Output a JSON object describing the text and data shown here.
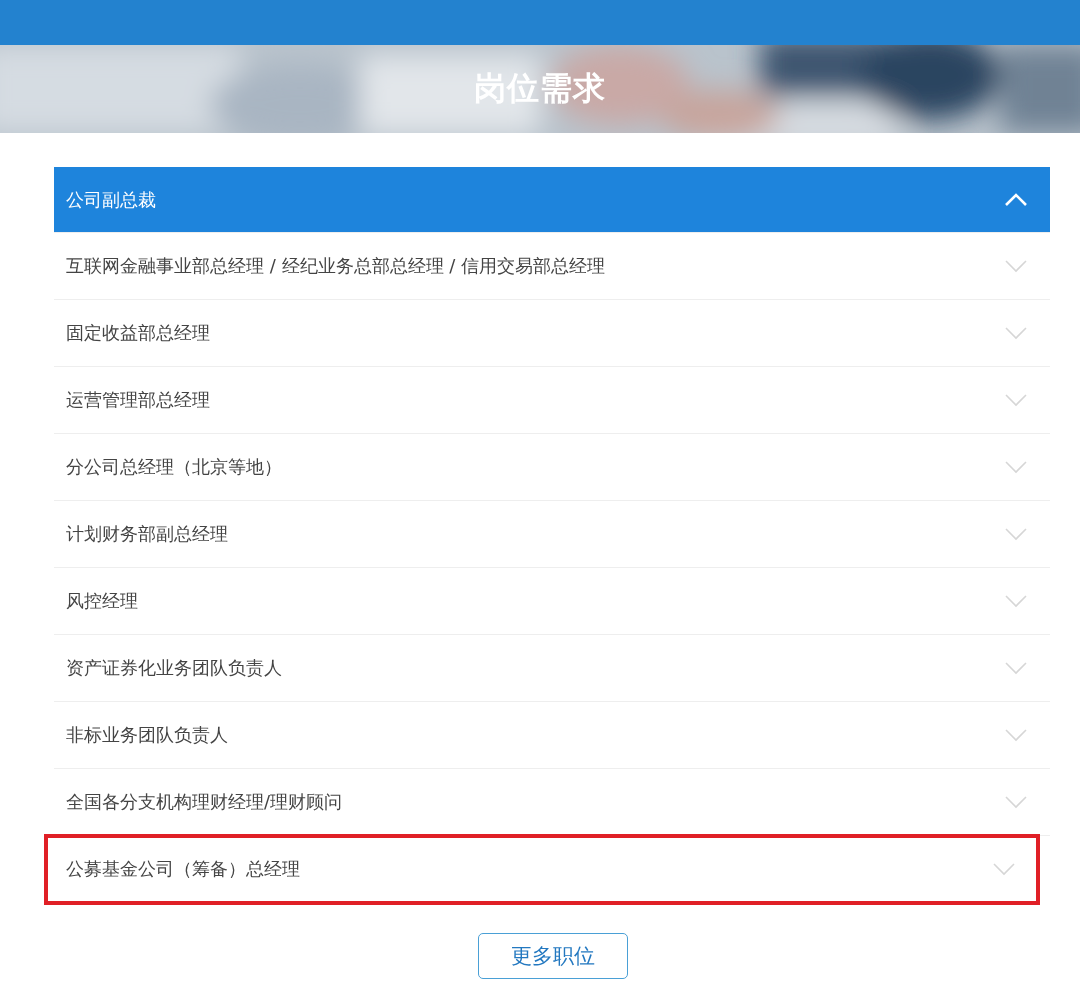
{
  "banner": {
    "title": "岗位需求",
    "kind": "picture"
  },
  "positions": [
    {
      "title": "公司副总裁",
      "expanded": true,
      "highlighted": false
    },
    {
      "title": "互联网金融事业部总经理 / 经纪业务总部总经理 / 信用交易部总经理",
      "expanded": false,
      "highlighted": false
    },
    {
      "title": "固定收益部总经理",
      "expanded": false,
      "highlighted": false
    },
    {
      "title": "运营管理部总经理",
      "expanded": false,
      "highlighted": false
    },
    {
      "title": "分公司总经理（北京等地）",
      "expanded": false,
      "highlighted": false
    },
    {
      "title": "计划财务部副总经理",
      "expanded": false,
      "highlighted": false
    },
    {
      "title": "风控经理",
      "expanded": false,
      "highlighted": false
    },
    {
      "title": "资产证券化业务团队负责人",
      "expanded": false,
      "highlighted": false
    },
    {
      "title": "非标业务团队负责人",
      "expanded": false,
      "highlighted": false
    },
    {
      "title": "全国各分支机构理财经理/理财顾问",
      "expanded": false,
      "highlighted": false
    },
    {
      "title": "公募基金公司（筹备）总经理",
      "expanded": false,
      "highlighted": true
    }
  ],
  "more_button": "更多职位"
}
